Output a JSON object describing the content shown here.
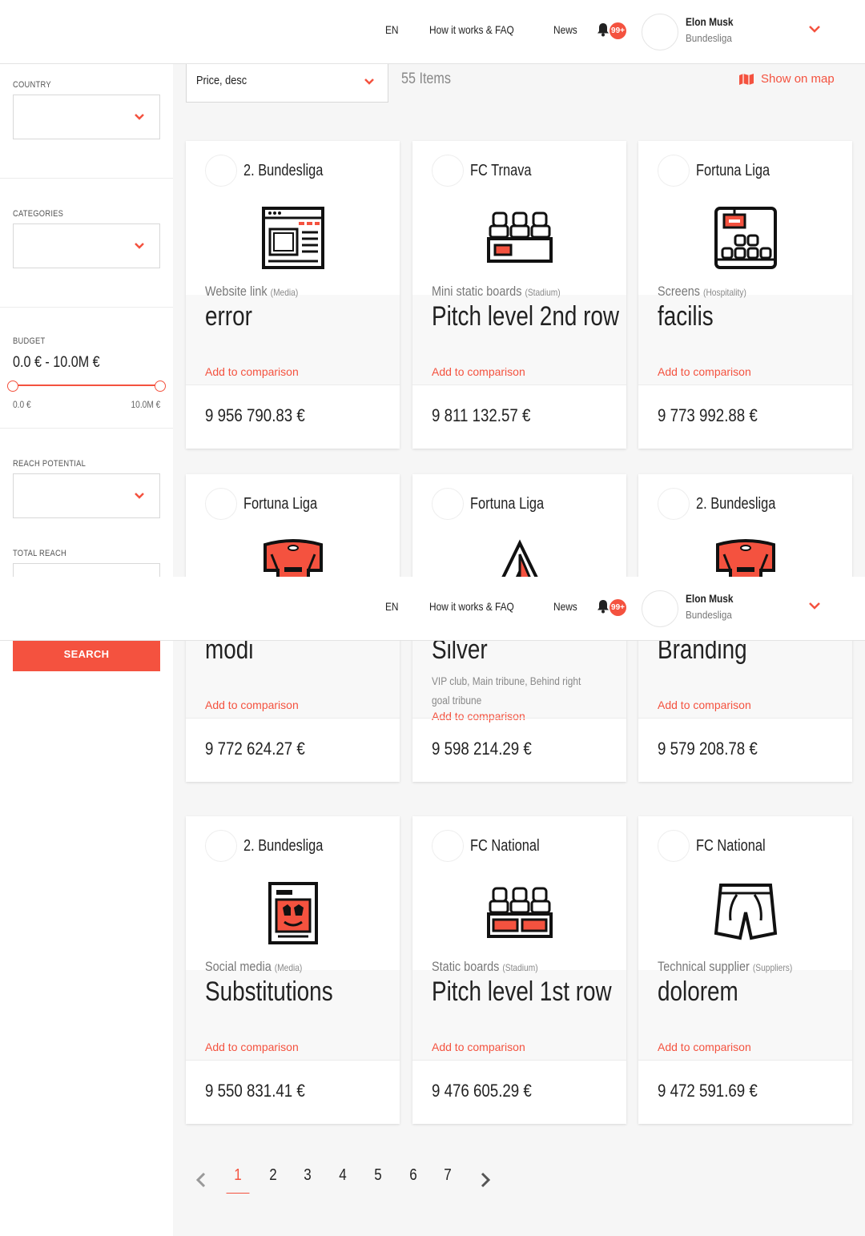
{
  "header": {
    "language": "EN",
    "nav_faq": "How it works & FAQ",
    "nav_news": "News",
    "notifications_badge": "99+",
    "user_name": "Elon Musk",
    "user_league": "Bundesliga"
  },
  "sidebar": {
    "country_label": "COUNTRY",
    "categories_label": "CATEGORIES",
    "budget_label": "BUDGET",
    "budget_value": "0.0 € - 10.0M €",
    "budget_min": "0.0 €",
    "budget_max": "10.0M €",
    "reach_potential_label": "REACH POTENTIAL",
    "total_reach_label": "TOTAL REACH",
    "search_button": "SEARCH"
  },
  "toolbar": {
    "sort_value": "Price, desc",
    "item_count": "55 Items",
    "show_on_map": "Show on map"
  },
  "cards": [
    {
      "league": "2. Bundesliga",
      "category": "Website link",
      "group": "(Media)",
      "title": "error",
      "description": "",
      "compare": "Add to comparison",
      "price": "9 956 790.83 €",
      "icon": "website-icon"
    },
    {
      "league": "FC Trnava",
      "category": "Mini static boards",
      "group": "(Stadium)",
      "title": "Pitch level 2nd row",
      "description": "",
      "compare": "Add to comparison",
      "price": "9 811 132.57 €",
      "icon": "stadium-seats-icon"
    },
    {
      "league": "Fortuna Liga",
      "category": "Screens",
      "group": "(Hospitality)",
      "title": "facilis",
      "description": "",
      "compare": "Add to comparison",
      "price": "9 773 992.88 €",
      "icon": "screen-seats-icon"
    },
    {
      "league": "Fortuna Liga",
      "category": "",
      "group": "",
      "title": "modi",
      "description": "",
      "compare": "Add to comparison",
      "price": "9 772 624.27 €",
      "icon": "jersey-icon"
    },
    {
      "league": "Fortuna Liga",
      "category": "",
      "group": "",
      "title": "Silver",
      "description": "VIP club, Main tribune, Behind right goal tribune",
      "compare": "Add to comparison",
      "price": "9 598 214.29 €",
      "icon": "brand-icon"
    },
    {
      "league": "2. Bundesliga",
      "category": "",
      "group": "",
      "title": "Branding",
      "description": "",
      "compare": "Add to comparison",
      "price": "9 579 208.78 €",
      "icon": "jersey-icon"
    },
    {
      "league": "2. Bundesliga",
      "category": "Social media",
      "group": "(Media)",
      "title": "Substitutions",
      "description": "",
      "compare": "Add to comparison",
      "price": "9 550 831.41 €",
      "icon": "social-media-icon"
    },
    {
      "league": "FC National",
      "category": "Static boards",
      "group": "(Stadium)",
      "title": "Pitch level 1st row",
      "description": "",
      "compare": "Add to comparison",
      "price": "9 476 605.29 €",
      "icon": "stadium-boards-icon"
    },
    {
      "league": "FC National",
      "category": "Technical supplier",
      "group": "(Suppliers)",
      "title": "dolorem",
      "description": "",
      "compare": "Add to comparison",
      "price": "9 472 591.69 €",
      "icon": "shorts-icon"
    }
  ],
  "pagination": {
    "pages": [
      "1",
      "2",
      "3",
      "4",
      "5",
      "6",
      "7"
    ],
    "current": "1"
  },
  "colors": {
    "accent": "#f4523f",
    "background": "#f6f6f6"
  }
}
